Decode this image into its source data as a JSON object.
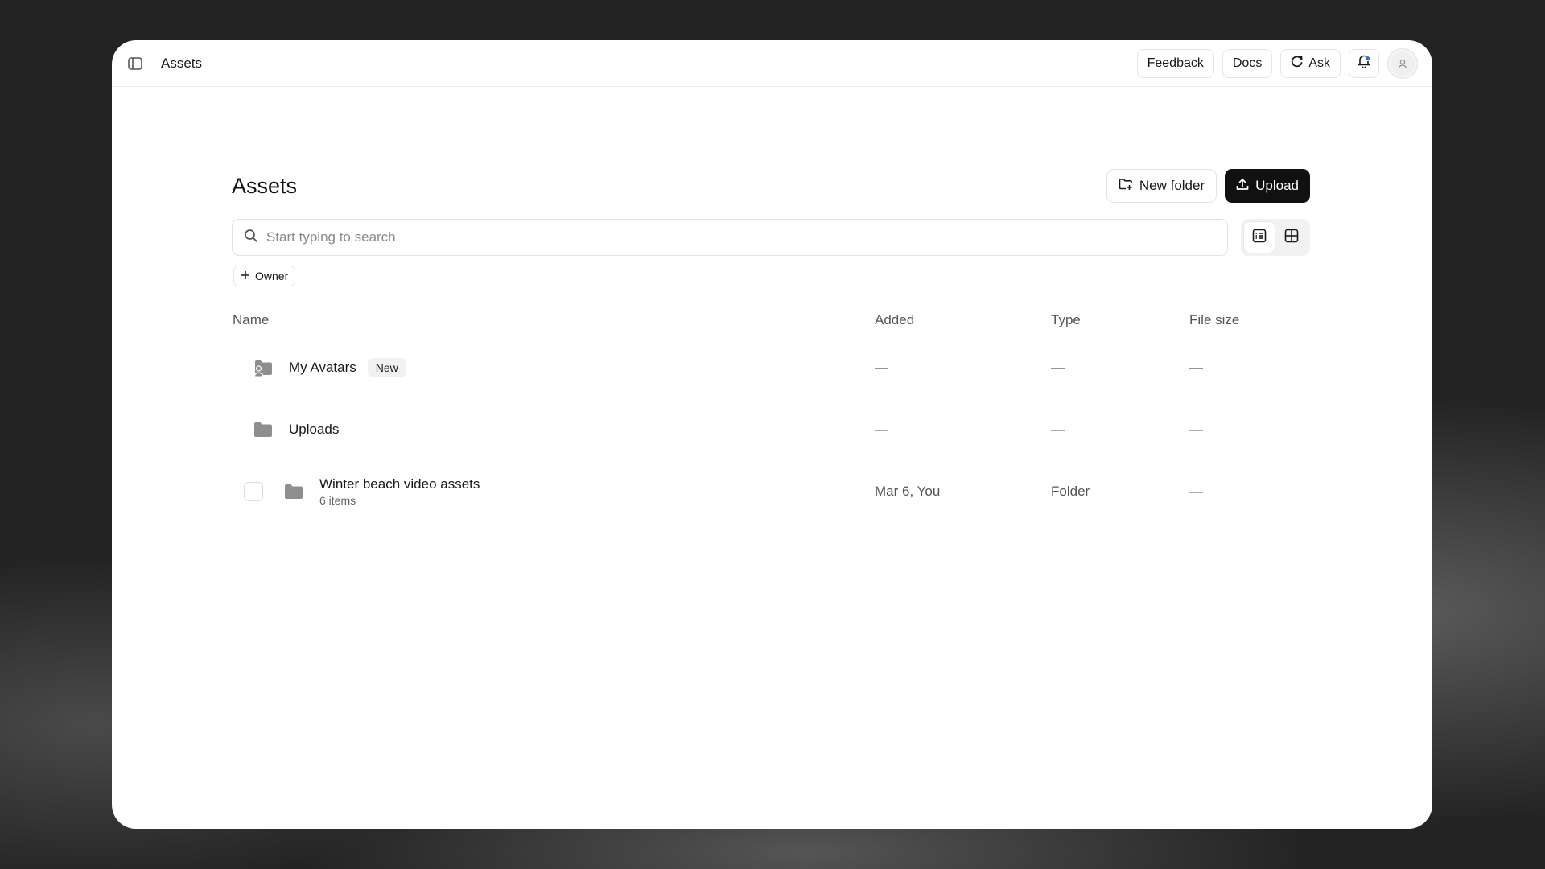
{
  "topbar": {
    "title": "Assets",
    "feedback_label": "Feedback",
    "docs_label": "Docs",
    "ask_label": "Ask"
  },
  "page": {
    "title": "Assets",
    "new_folder_label": "New folder",
    "upload_label": "Upload"
  },
  "search": {
    "placeholder": "Start typing to search",
    "value": ""
  },
  "filters": {
    "owner_label": "Owner"
  },
  "table": {
    "columns": [
      "Name",
      "Added",
      "Type",
      "File size"
    ],
    "rows": [
      {
        "name": "My Avatars",
        "badge": "New",
        "added": "—",
        "type": "—",
        "size": "—"
      },
      {
        "name": "Uploads",
        "added": "—",
        "type": "—",
        "size": "—"
      },
      {
        "name": "Winter beach video assets",
        "subtext": "6 items",
        "added": "Mar 6, You",
        "type": "Folder",
        "size": "—"
      }
    ]
  },
  "colors": {
    "primary": "#111111",
    "notification_dot": "#2d6cdf",
    "folder_icon": "#8e8e8e"
  },
  "icons": {
    "sidebar_toggle": "sidebar-toggle-icon",
    "ask": "ask-icon",
    "notification": "bell-icon",
    "avatar": "user-icon",
    "new_folder": "folder-plus-icon",
    "upload": "upload-icon",
    "search": "search-icon",
    "list_view": "list-view-icon",
    "grid_view": "grid-view-icon",
    "plus": "plus-icon",
    "folder": "folder-icon",
    "avatar_folder": "avatar-folder-icon"
  }
}
